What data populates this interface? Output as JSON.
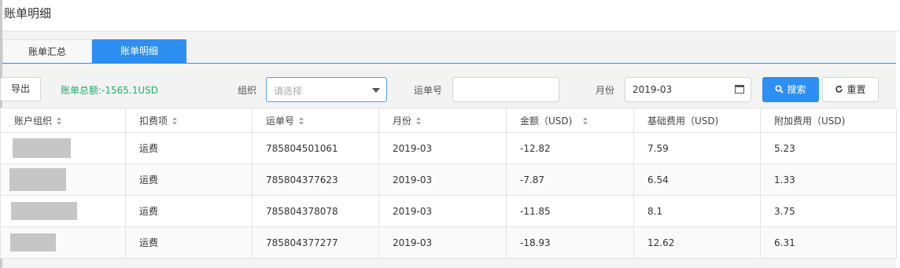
{
  "page": {
    "title": "账单明细"
  },
  "tabs": {
    "summary": "账单汇总",
    "detail": "账单明细"
  },
  "toolbar": {
    "export_label": "导出",
    "total_text": "账单总额:-1565.1USD",
    "org_label": "组织",
    "org_placeholder": "请选择",
    "waybill_label": "运单号",
    "waybill_value": "",
    "month_label": "月份",
    "month_value": "2019-03",
    "search_label": "搜索",
    "reset_label": "重置"
  },
  "table": {
    "headers": [
      "账户组织",
      "扣费项",
      "运单号",
      "月份",
      "金额（USD)",
      "基础费用（USD)",
      "附加费用（USD)"
    ],
    "rows": [
      {
        "org": "",
        "item": "运费",
        "waybill": "785804501061",
        "month": "2019-03",
        "amount": "-12.82",
        "base": "7.59",
        "extra": "5.23"
      },
      {
        "org": "",
        "item": "运费",
        "waybill": "785804377623",
        "month": "2019-03",
        "amount": "-7.87",
        "base": "6.54",
        "extra": "1.33"
      },
      {
        "org": "",
        "item": "运费",
        "waybill": "785804378078",
        "month": "2019-03",
        "amount": "-11.85",
        "base": "8.1",
        "extra": "3.75"
      },
      {
        "org": "",
        "item": "运费",
        "waybill": "785804377277",
        "month": "2019-03",
        "amount": "-18.93",
        "base": "12.62",
        "extra": "6.31"
      }
    ]
  },
  "colors": {
    "primary": "#2e8ff2",
    "total_green": "#1ab06a"
  }
}
